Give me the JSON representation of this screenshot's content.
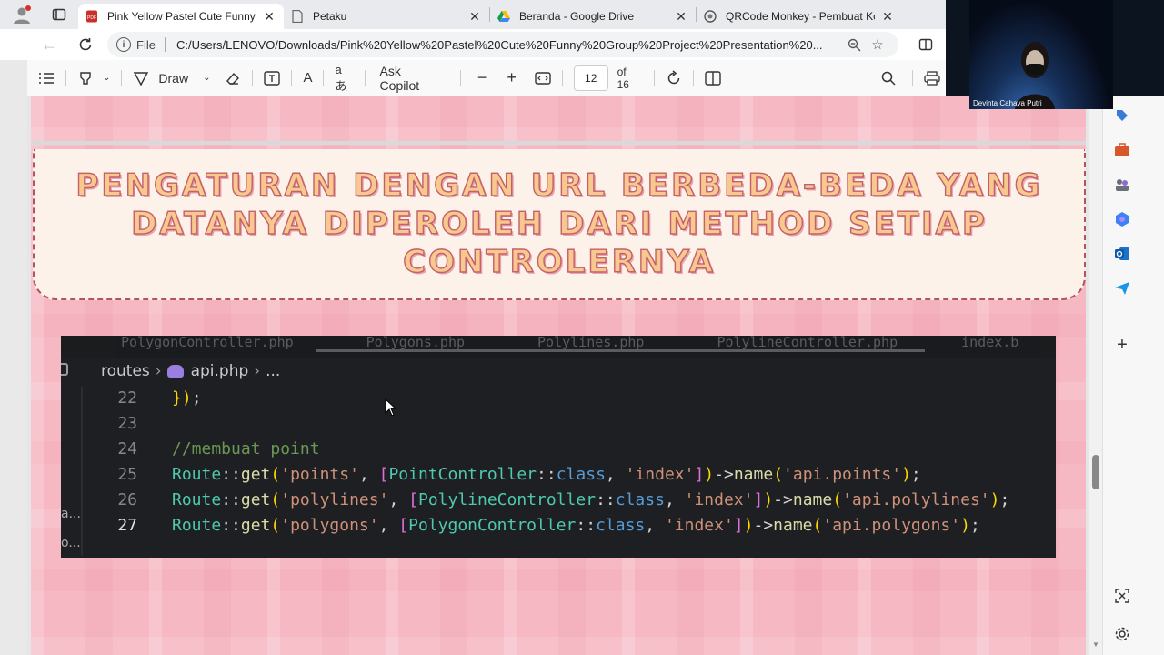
{
  "browser": {
    "tabs": [
      {
        "label": "Pink Yellow Pastel Cute Funny Gr",
        "favicon": "pdf-icon",
        "active": true
      },
      {
        "label": "Petaku",
        "favicon": "page-icon",
        "active": false
      },
      {
        "label": "Beranda - Google Drive",
        "favicon": "google-drive-icon",
        "active": false
      },
      {
        "label": "QRCode Monkey - Pembuat Kod",
        "favicon": "qrcode-monkey-icon",
        "active": false
      }
    ],
    "address": {
      "scheme": "File",
      "url": "C:/Users/LENOVO/Downloads/Pink%20Yellow%20Pastel%20Cute%20Funny%20Group%20Project%20Presentation%20..."
    }
  },
  "pdf_toolbar": {
    "draw_label": "Draw",
    "copilot_label": "Ask Copilot",
    "page_current": "12",
    "page_total": "of 16",
    "read_aloud_glyph": "A",
    "translate_glyph": "aあ"
  },
  "slide": {
    "title": "Pengaturan dengan URL berbeda-beda yang datanya diperoleh dari method setiap controlernya",
    "code": {
      "tabs": [
        "PolygonController.php",
        "Polygons.php",
        "Polylines.php",
        "PolylineController.php",
        "index.b"
      ],
      "breadcrumb": {
        "folder": "routes",
        "file": "api.php",
        "more": "..."
      },
      "side_labels": [
        "a...",
        "o..."
      ],
      "lines": [
        {
          "num": "22",
          "text": "});"
        },
        {
          "num": "23",
          "text": ""
        },
        {
          "num": "24",
          "text": "//membuat point"
        },
        {
          "num": "25",
          "text": "Route::get('points', [PointController::class, 'index'])->name('api.points');"
        },
        {
          "num": "26",
          "text": "Route::get('polylines', [PolylineController::class, 'index'])->name('api.polylines');"
        },
        {
          "num": "27",
          "text": "Route::get('polygons', [PolygonController::class, 'index'])->name('api.polygons');"
        }
      ]
    }
  },
  "webcam": {
    "name": "Devinta Cahaya Putri"
  },
  "colors": {
    "accent_pink": "#f6b8c3",
    "title_fill": "#f7c98e",
    "title_stroke": "#c45f6c",
    "code_bg": "#1e1f22"
  }
}
